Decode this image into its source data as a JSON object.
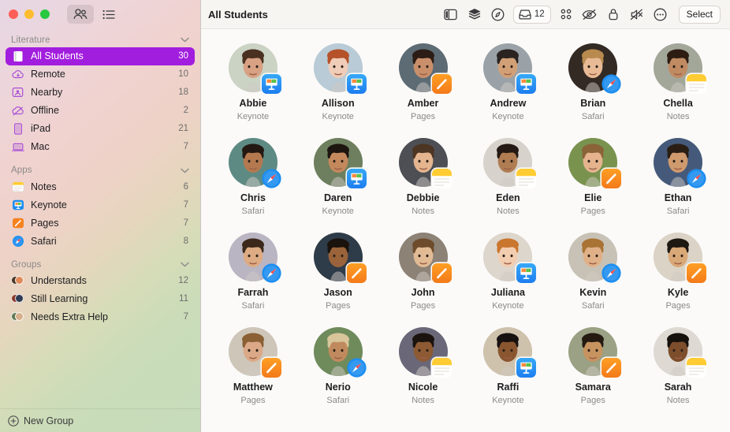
{
  "window": {
    "traffic_lights": [
      "close",
      "minimize",
      "zoom"
    ],
    "view_toggle": {
      "grid_label": "people-grid-view",
      "list_label": "list-view"
    }
  },
  "toolbar": {
    "title": "All Students",
    "inbox_count": "12",
    "select_label": "Select",
    "icons": [
      "sidebar-toggle-icon",
      "layers-icon",
      "navigate-icon",
      "inbox-icon",
      "apps-grid-icon",
      "hide-screen-icon",
      "lock-screen-icon",
      "mute-icon",
      "more-options-icon"
    ]
  },
  "sidebar": {
    "sections": [
      {
        "title": "Literature",
        "items": [
          {
            "label": "All Students",
            "count": "30",
            "icon": "book-icon",
            "selected": true
          },
          {
            "label": "Remote",
            "count": "10",
            "icon": "cloud-download-icon",
            "selected": false
          },
          {
            "label": "Nearby",
            "count": "18",
            "icon": "person-badge-icon",
            "selected": false
          },
          {
            "label": "Offline",
            "count": "2",
            "icon": "cloud-slash-icon",
            "selected": false
          },
          {
            "label": "iPad",
            "count": "21",
            "icon": "ipad-icon",
            "selected": false
          },
          {
            "label": "Mac",
            "count": "7",
            "icon": "mac-icon",
            "selected": false
          }
        ]
      },
      {
        "title": "Apps",
        "items": [
          {
            "label": "Notes",
            "count": "6",
            "icon": "notes-app-icon",
            "selected": false
          },
          {
            "label": "Keynote",
            "count": "7",
            "icon": "keynote-app-icon",
            "selected": false
          },
          {
            "label": "Pages",
            "count": "7",
            "icon": "pages-app-icon",
            "selected": false
          },
          {
            "label": "Safari",
            "count": "8",
            "icon": "safari-app-icon",
            "selected": false
          }
        ]
      },
      {
        "title": "Groups",
        "items": [
          {
            "label": "Understands",
            "count": "12",
            "icon": "group-avatars-icon",
            "selected": false
          },
          {
            "label": "Still Learning",
            "count": "11",
            "icon": "group-avatars-icon",
            "selected": false
          },
          {
            "label": "Needs Extra Help",
            "count": "7",
            "icon": "group-avatars-icon",
            "selected": false
          }
        ]
      }
    ],
    "footer": {
      "label": "New Group",
      "icon": "plus-circle-icon"
    }
  },
  "students": [
    {
      "name": "Abbie",
      "app": "Keynote",
      "skin": "#d8a184",
      "hair": "#4a3020",
      "bg": "#cbd3c4"
    },
    {
      "name": "Allison",
      "app": "Keynote",
      "skin": "#f0cdb8",
      "hair": "#b5522a",
      "bg": "#b9cbd6"
    },
    {
      "name": "Amber",
      "app": "Pages",
      "skin": "#c98f6a",
      "hair": "#2b1d16",
      "bg": "#5d6b74"
    },
    {
      "name": "Andrew",
      "app": "Keynote",
      "skin": "#d2a077",
      "hair": "#2a2320",
      "bg": "#9aa2a8"
    },
    {
      "name": "Brian",
      "app": "Safari",
      "skin": "#e8bb96",
      "hair": "#b98a4e",
      "bg": "#332a24"
    },
    {
      "name": "Chella",
      "app": "Notes",
      "skin": "#c08a62",
      "hair": "#2d1c12",
      "bg": "#a3a79a"
    },
    {
      "name": "Chris",
      "app": "Safari",
      "skin": "#b4794f",
      "hair": "#241812",
      "bg": "#5e8a84"
    },
    {
      "name": "Daren",
      "app": "Keynote",
      "skin": "#c4885d",
      "hair": "#1d1510",
      "bg": "#6d7f5e"
    },
    {
      "name": "Debbie",
      "app": "Notes",
      "skin": "#e4b58f",
      "hair": "#4c3522",
      "bg": "#4d4f55"
    },
    {
      "name": "Eden",
      "app": "Notes",
      "skin": "#b07c52",
      "hair": "#251a13",
      "bg": "#d7d2cb"
    },
    {
      "name": "Elie",
      "app": "Pages",
      "skin": "#e5b48f",
      "hair": "#8a6338",
      "bg": "#79934f"
    },
    {
      "name": "Ethan",
      "app": "Safari",
      "skin": "#cf9a6e",
      "hair": "#2a1d14",
      "bg": "#455a7a"
    },
    {
      "name": "Farrah",
      "app": "Safari",
      "skin": "#ddab84",
      "hair": "#3b281a",
      "bg": "#b9b5c2"
    },
    {
      "name": "Jason",
      "app": "Pages",
      "skin": "#9a6339",
      "hair": "#1a120c",
      "bg": "#2e3b48"
    },
    {
      "name": "John",
      "app": "Pages",
      "skin": "#e2bb95",
      "hair": "#6d4c2c",
      "bg": "#8d8276"
    },
    {
      "name": "Juliana",
      "app": "Keynote",
      "skin": "#f2cdb0",
      "hair": "#c9762e",
      "bg": "#ddd6cd"
    },
    {
      "name": "Kevin",
      "app": "Safari",
      "skin": "#e0b189",
      "hair": "#a97334",
      "bg": "#c8c2b6"
    },
    {
      "name": "Kyle",
      "app": "Pages",
      "skin": "#d9a877",
      "hair": "#1e1812",
      "bg": "#dbd3c6"
    },
    {
      "name": "Matthew",
      "app": "Pages",
      "skin": "#dba987",
      "hair": "#8a6034",
      "bg": "#cfc6ba"
    },
    {
      "name": "Nerio",
      "app": "Safari",
      "skin": "#c08a5e",
      "hair": "#d8c59a",
      "bg": "#6f8b5c"
    },
    {
      "name": "Nicole",
      "app": "Notes",
      "skin": "#8d5a33",
      "hair": "#1b130e",
      "bg": "#6a6878"
    },
    {
      "name": "Raffi",
      "app": "Keynote",
      "skin": "#8a5630",
      "hair": "#171110",
      "bg": "#cfc2ac"
    },
    {
      "name": "Samara",
      "app": "Pages",
      "skin": "#c7935f",
      "hair": "#241a12",
      "bg": "#9aa184"
    },
    {
      "name": "Sarah",
      "app": "Notes",
      "skin": "#7d4e2c",
      "hair": "#17110d",
      "bg": "#ded9d3"
    }
  ]
}
